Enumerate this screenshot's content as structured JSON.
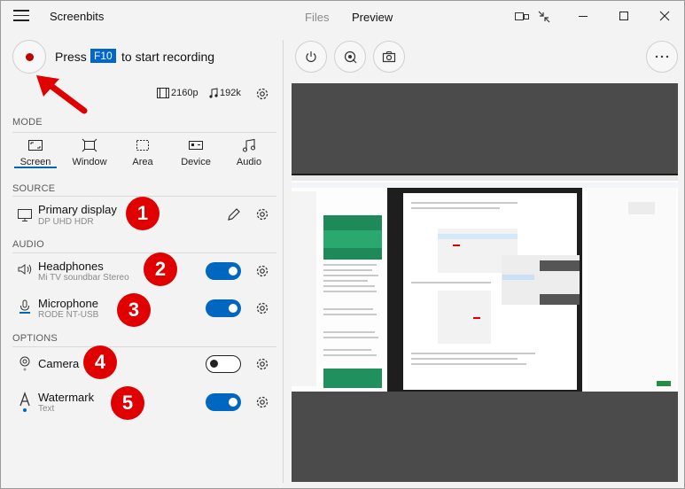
{
  "app": {
    "title": "Screenbits"
  },
  "tabs": [
    {
      "label": "Files"
    },
    {
      "label": "Preview"
    }
  ],
  "recording": {
    "press": "Press",
    "key": "F10",
    "rest": "to start recording"
  },
  "quality": {
    "video": "2160p",
    "audio": "192k"
  },
  "sections": {
    "mode": "MODE",
    "source": "SOURCE",
    "audio": "AUDIO",
    "options": "OPTIONS"
  },
  "modes": [
    {
      "label": "Screen",
      "icon": "screen-icon",
      "selected": true
    },
    {
      "label": "Window",
      "icon": "window-icon"
    },
    {
      "label": "Area",
      "icon": "area-icon"
    },
    {
      "label": "Device",
      "icon": "device-icon"
    },
    {
      "label": "Audio",
      "icon": "music-note-icon"
    }
  ],
  "source": {
    "title": "Primary display",
    "subtitle": "DP UHD HDR",
    "badge": "1"
  },
  "audio": [
    {
      "title": "Headphones",
      "subtitle": "Mi TV soundbar Stereo",
      "badge": "2",
      "enabled": true
    },
    {
      "title": "Microphone",
      "subtitle": "RODE NT-USB",
      "badge": "3",
      "enabled": true
    }
  ],
  "options": [
    {
      "title": "Camera",
      "subtitle": "",
      "badge": "4",
      "enabled": false
    },
    {
      "title": "Watermark",
      "subtitle": "Text",
      "badge": "5",
      "enabled": true
    }
  ],
  "colors": {
    "accent": "#0067c0",
    "record": "#c00000",
    "badge": "#e00000",
    "preview_bg": "#4b4b4b"
  }
}
